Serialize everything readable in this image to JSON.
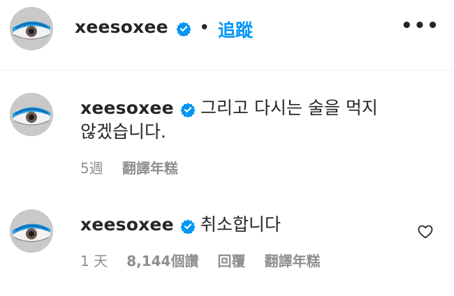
{
  "post": {
    "username": "xeesoxee",
    "separator": "•",
    "follow_label": "追蹤",
    "more_label": "•••"
  },
  "comments": [
    {
      "username": "xeesoxee",
      "text_line1": "그리고 다시는 술을 먹지",
      "text_line2": "않겠습니다.",
      "time": "5週",
      "translate": "翻譯年糕"
    },
    {
      "username": "xeesoxee",
      "text": "취소합니다",
      "time": "1 天",
      "likes": "8,144個讚",
      "reply": "回覆",
      "translate": "翻譯年糕"
    }
  ],
  "colors": {
    "accent": "#0095f6",
    "text": "#262626",
    "muted": "#8e8e8e"
  },
  "icons": [
    "verified-badge-icon",
    "more-options-icon",
    "heart-icon"
  ]
}
